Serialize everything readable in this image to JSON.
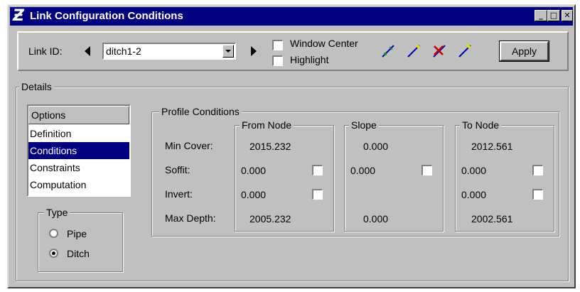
{
  "window": {
    "title": "Link Configuration Conditions",
    "minimize_glyph": "_",
    "maximize_glyph": "□",
    "close_glyph": "✕"
  },
  "toolbar": {
    "link_id_label": "Link ID:",
    "link_id_value": "ditch1-2",
    "window_center_label": "Window Center",
    "highlight_label": "Highlight",
    "apply_label": "Apply",
    "tool_icons": [
      "add-link-icon",
      "select-link-icon",
      "delete-link-icon",
      "edit-link-icon"
    ]
  },
  "details": {
    "legend": "Details",
    "options_header": "Options",
    "options": [
      "Definition",
      "Conditions",
      "Constraints",
      "Computation"
    ],
    "selected_option": "Conditions",
    "type": {
      "legend": "Type",
      "options": [
        "Pipe",
        "Ditch"
      ],
      "selected": "Ditch"
    }
  },
  "profile": {
    "legend": "Profile Conditions",
    "row_labels": {
      "min_cover": "Min Cover:",
      "soffit": "Soffit:",
      "invert": "Invert:",
      "max_depth": "Max Depth:"
    },
    "from_node": {
      "legend": "From Node",
      "min_cover": "2015.232",
      "soffit": "0.000",
      "invert": "0.000",
      "max_depth": "2005.232"
    },
    "slope": {
      "legend": "Slope",
      "min_cover": "0.000",
      "soffit": "0.000",
      "max_depth": "0.000"
    },
    "to_node": {
      "legend": "To Node",
      "min_cover": "2012.561",
      "soffit": "0.000",
      "invert": "0.000",
      "max_depth": "2002.561"
    }
  },
  "colors": {
    "title_bar": "#000080",
    "face": "#c0c0c0",
    "selection": "#000080"
  }
}
